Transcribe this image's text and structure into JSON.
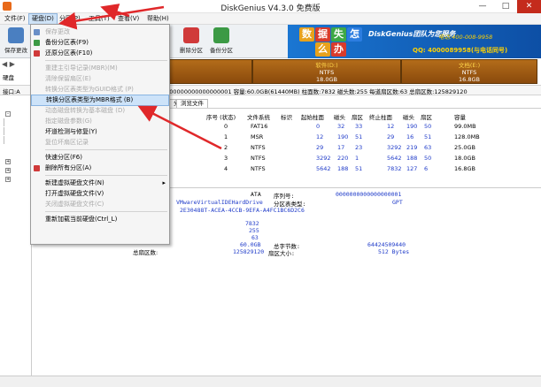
{
  "window": {
    "title": "DiskGenius V4.3.0 免费版",
    "minimize_glyph": "—",
    "maximize_glyph": "□",
    "close_glyph": "✕"
  },
  "menubar": {
    "items": [
      "文件(F)",
      "硬盘(D)",
      "分区(P)",
      "工具(T)",
      "查看(V)",
      "帮助(H)"
    ],
    "active_index": 1
  },
  "toolbar": {
    "buttons": [
      {
        "label": "保存更改",
        "icon": "save-icon",
        "color": "#4a7fc1"
      },
      {
        "label": "删除分区",
        "icon": "delete-partition-icon",
        "color": "#d03a3a"
      },
      {
        "label": "备份分区",
        "icon": "backup-partition-icon",
        "color": "#3c9a45"
      }
    ]
  },
  "banner": {
    "tiles": [
      "数",
      "据",
      "失",
      "怎",
      "么",
      "办"
    ],
    "tile_colors": [
      "#e8a21c",
      "#d93b2b",
      "#3fa845",
      "#2c7de0",
      "#e8a21c",
      "#d93b2b"
    ],
    "brand": "DiskGenius团队为您服务",
    "phone": "电话:400-008-9958",
    "qq": "QQ: 4000089958(与电话同号)"
  },
  "disk_strip": {
    "label": "硬盘",
    "partitions": [
      {
        "name": "软件(D:)",
        "fs": "NTFS",
        "size": "18.0GB"
      },
      {
        "name": "文档(E:)",
        "fs": "NTFS",
        "size": "16.8GB"
      }
    ]
  },
  "infobar": {
    "prefix": "接口:A",
    "text": "0000000000000000001  容量:60.0GB(61440MB)  柱面数:7832  磁头数:255  每道扇区数:63  总扇区数:125829120"
  },
  "tabs": [
    "分区参数",
    "浏览文件"
  ],
  "partition_table": {
    "headers": [
      "序号 (状态)",
      "文件系统",
      "标识",
      "起始柱面",
      "磁头",
      "扇区",
      "终止柱面",
      "磁头",
      "扇区",
      "容量"
    ],
    "rows": [
      {
        "num": "0",
        "fs": "FAT16",
        "id": "",
        "sc": "0",
        "sh": "32",
        "ss": "33",
        "ec": "12",
        "eh": "190",
        "es": "50",
        "size": "99.0MB"
      },
      {
        "num": "1",
        "fs": "MSR",
        "id": "",
        "sc": "12",
        "sh": "190",
        "ss": "51",
        "ec": "29",
        "eh": "16",
        "es": "51",
        "size": "128.0MB"
      },
      {
        "num": "2",
        "fs": "NTFS",
        "id": "",
        "sc": "29",
        "sh": "17",
        "ss": "23",
        "ec": "3292",
        "eh": "219",
        "es": "63",
        "size": "25.0GB"
      },
      {
        "num": "3",
        "fs": "NTFS",
        "id": "",
        "sc": "3292",
        "sh": "220",
        "ss": "1",
        "ec": "5642",
        "eh": "188",
        "es": "50",
        "size": "18.0GB"
      },
      {
        "num": "4",
        "fs": "NTFS",
        "id": "",
        "sc": "5642",
        "sh": "188",
        "ss": "51",
        "ec": "7832",
        "eh": "127",
        "es": "6",
        "size": "16.8GB"
      }
    ]
  },
  "details": {
    "interface": "ATA",
    "model": "VMwareVirtualIDEHardDrive",
    "guid": "2E30488T-ACEA-4CCB-9EFA-A4FC1BC6D2C6",
    "serial_label": "序列号:",
    "serial_value": "0000000000000000001",
    "ptype_label": "分区表类型:",
    "ptype_value": "GPT",
    "cylinders": "7832",
    "heads": "255",
    "sectors": "63",
    "capacity": "60.0GB",
    "total_bytes_label": "总字节数:",
    "total_bytes_value": "64424509440",
    "total_sectors_label": "总扇区数:",
    "total_sectors_value": "125829120",
    "sector_size_label": "扇区大小:",
    "sector_size_value": "512 Bytes"
  },
  "dropdown": {
    "items": [
      {
        "label": "保存更改",
        "enabled": false,
        "icon": "save-icon",
        "color": "#6a8fc7"
      },
      {
        "label": "备份分区表(F9)",
        "enabled": true,
        "icon": "backup-table-icon",
        "color": "#3c9a45"
      },
      {
        "label": "还原分区表(F10)",
        "enabled": true,
        "icon": "restore-table-icon",
        "color": "#d03a3a"
      },
      {
        "sep": true
      },
      {
        "label": "重建主引导记录(MBR)(M)",
        "enabled": false
      },
      {
        "label": "清除保留扇区(E)",
        "enabled": false
      },
      {
        "label": "转换分区表类型为GUID格式 (P)",
        "enabled": false
      },
      {
        "label": "转换分区表类型为MBR格式 (B)",
        "enabled": true,
        "highlight": true
      },
      {
        "label": "动态磁盘转换为基本磁盘 (D)",
        "enabled": false
      },
      {
        "label": "指定磁盘参数(G)",
        "enabled": false
      },
      {
        "label": "坏道检测与修复(Y)",
        "enabled": true
      },
      {
        "label": "复位坏扇区记录",
        "enabled": false
      },
      {
        "sep": true
      },
      {
        "label": "快速分区(F6)",
        "enabled": true
      },
      {
        "label": "删除所有分区(A)",
        "enabled": true,
        "icon": "delete-all-icon",
        "color": "#d03a3a"
      },
      {
        "sep": true
      },
      {
        "label": "新建虚拟硬盘文件(N)",
        "enabled": true,
        "submenu": true
      },
      {
        "label": "打开虚拟硬盘文件(V)",
        "enabled": true
      },
      {
        "label": "关闭虚拟硬盘文件(C)",
        "enabled": false
      },
      {
        "sep": true
      },
      {
        "label": "重新加载当前硬盘(Ctrl_L)",
        "enabled": true
      }
    ]
  }
}
